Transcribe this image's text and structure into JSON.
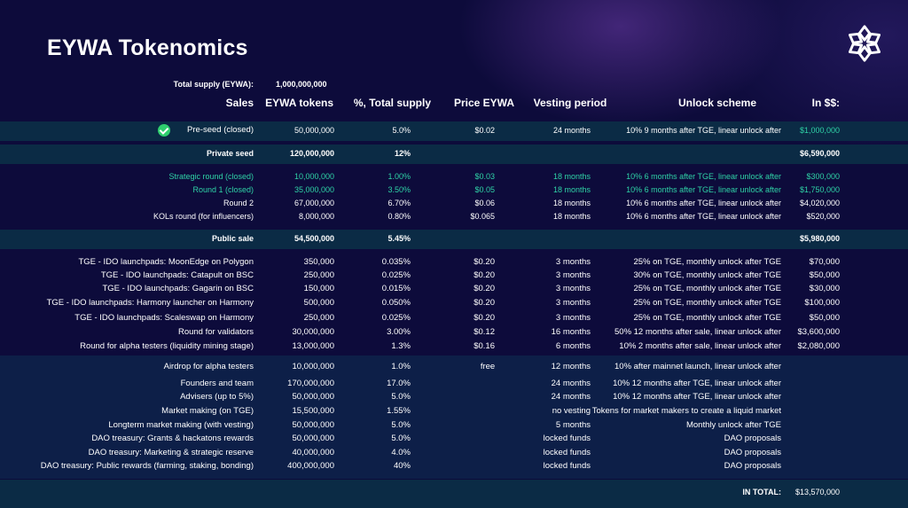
{
  "title": "EYWA Tokenomics",
  "total_supply": {
    "label": "Total supply (EYWA):",
    "value": "1,000,000,000"
  },
  "headers": {
    "sales": "Sales",
    "tokens": "EYWA tokens",
    "pct": "%, Total supply",
    "price": "Price EYWA",
    "vesting": "Vesting period",
    "unlock": "Unlock scheme",
    "usd": "In $$:"
  },
  "rows": [
    {
      "name": "Pre-seed (closed)",
      "tokens": "50,000,000",
      "pct": "5.0%",
      "price": "$0.02",
      "vesting": "24 months",
      "unlock": "10% 9 months after TGE, linear unlock after",
      "usd": "$1,000,000"
    },
    {
      "name": "Private seed",
      "tokens": "120,000,000",
      "pct": "12%",
      "price": "",
      "vesting": "",
      "unlock": "",
      "usd": "$6,590,000"
    },
    {
      "name": "Strategic round (closed)",
      "tokens": "10,000,000",
      "pct": "1.00%",
      "price": "$0.03",
      "vesting": "18 months",
      "unlock": "10% 6 months after TGE, linear unlock after",
      "usd": "$300,000"
    },
    {
      "name": "Round 1  (closed)",
      "tokens": "35,000,000",
      "pct": "3.50%",
      "price": "$0.05",
      "vesting": "18 months",
      "unlock": "10% 6 months after TGE, linear unlock after",
      "usd": "$1,750,000"
    },
    {
      "name": "Round 2",
      "tokens": "67,000,000",
      "pct": "6.70%",
      "price": "$0.06",
      "vesting": "18 months",
      "unlock": "10% 6 months after TGE, linear unlock after",
      "usd": "$4,020,000"
    },
    {
      "name": "KOLs round (for influencers)",
      "tokens": "8,000,000",
      "pct": "0.80%",
      "price": "$0.065",
      "vesting": "18 months",
      "unlock": "10% 6 months after TGE, linear unlock after",
      "usd": "$520,000"
    },
    {
      "name": "Public sale",
      "tokens": "54,500,000",
      "pct": "5.45%",
      "price": "",
      "vesting": "",
      "unlock": "",
      "usd": "$5,980,000"
    },
    {
      "name": "TGE - IDO launchpads: MoonEdge on Polygon",
      "tokens": "350,000",
      "pct": "0.035%",
      "price": "$0.20",
      "vesting": "3 months",
      "unlock": "25% on TGE, monthly unlock after TGE",
      "usd": "$70,000"
    },
    {
      "name": "TGE - IDO launchpads: Catapult on BSC",
      "tokens": "250,000",
      "pct": "0.025%",
      "price": "$0.20",
      "vesting": "3 months",
      "unlock": "30% on TGE, monthly unlock after TGE",
      "usd": "$50,000"
    },
    {
      "name": "TGE - IDO launchpads: Gagarin on BSC",
      "tokens": "150,000",
      "pct": "0.015%",
      "price": "$0.20",
      "vesting": "3 months",
      "unlock": "25% on TGE, monthly unlock after TGE",
      "usd": "$30,000"
    },
    {
      "name": "TGE - IDO launchpads: Harmony launcher on Harmony",
      "tokens": "500,000",
      "pct": "0.050%",
      "price": "$0.20",
      "vesting": "3 months",
      "unlock": "25% on TGE, monthly unlock after TGE",
      "usd": "$100,000"
    },
    {
      "name": "TGE - IDO launchpads: Scaleswap on Harmony",
      "tokens": "250,000",
      "pct": "0.025%",
      "price": "$0.20",
      "vesting": "3 months",
      "unlock": "25% on TGE, monthly unlock after TGE",
      "usd": "$50,000"
    },
    {
      "name": "Round for validators",
      "tokens": "30,000,000",
      "pct": "3.00%",
      "price": "$0.12",
      "vesting": "16 months",
      "unlock": "50% 12 months after sale, linear unlock after",
      "usd": "$3,600,000"
    },
    {
      "name": "Round for alpha testers (liquidity mining stage)",
      "tokens": "13,000,000",
      "pct": "1.3%",
      "price": "$0.16",
      "vesting": "6 months",
      "unlock": "10% 2 months after sale, linear unlock after",
      "usd": "$2,080,000"
    },
    {
      "name": "Airdrop for alpha testers",
      "tokens": "10,000,000",
      "pct": "1.0%",
      "price": "free",
      "vesting": "12 months",
      "unlock": "10% after mainnet launch, linear unlock after",
      "usd": ""
    },
    {
      "name": "Founders and team",
      "tokens": "170,000,000",
      "pct": "17.0%",
      "price": "",
      "vesting": "24 months",
      "unlock": "10% 12 months after TGE, linear unlock after",
      "usd": ""
    },
    {
      "name": "Advisers (up to 5%)",
      "tokens": "50,000,000",
      "pct": "5.0%",
      "price": "",
      "vesting": "24 months",
      "unlock": "10% 12 months after TGE, linear unlock after",
      "usd": ""
    },
    {
      "name": "Market making (on TGE)",
      "tokens": "15,500,000",
      "pct": "1.55%",
      "price": "",
      "vesting": "no vesting",
      "unlock": "Tokens for market makers to create a liquid market",
      "usd": ""
    },
    {
      "name": "Longterm market making (with vesting)",
      "tokens": "50,000,000",
      "pct": "5.0%",
      "price": "",
      "vesting": "5 months",
      "unlock": "Monthly unlock after TGE",
      "usd": ""
    },
    {
      "name": "DAO treasury: Grants & hackatons rewards",
      "tokens": "50,000,000",
      "pct": "5.0%",
      "price": "",
      "vesting": "locked funds",
      "unlock": "DAO proposals",
      "usd": ""
    },
    {
      "name": "DAO treasury: Marketing & strategic reserve",
      "tokens": "40,000,000",
      "pct": "4.0%",
      "price": "",
      "vesting": "locked funds",
      "unlock": "DAO proposals",
      "usd": ""
    },
    {
      "name": "DAO treasury: Public rewards (farming, staking, bonding)",
      "tokens": "400,000,000",
      "pct": "40%",
      "price": "",
      "vesting": "locked funds",
      "unlock": "DAO proposals",
      "usd": ""
    }
  ],
  "total": {
    "label": "IN TOTAL:",
    "value": "$13,570,000"
  },
  "colors": {
    "background": "#0d0b3b",
    "band": "#0b2b45",
    "accent": "#2fd3a7",
    "check": "#2fcf6e"
  },
  "icons": {
    "logo": "eywa-logo-icon",
    "check": "check-circle-icon"
  }
}
